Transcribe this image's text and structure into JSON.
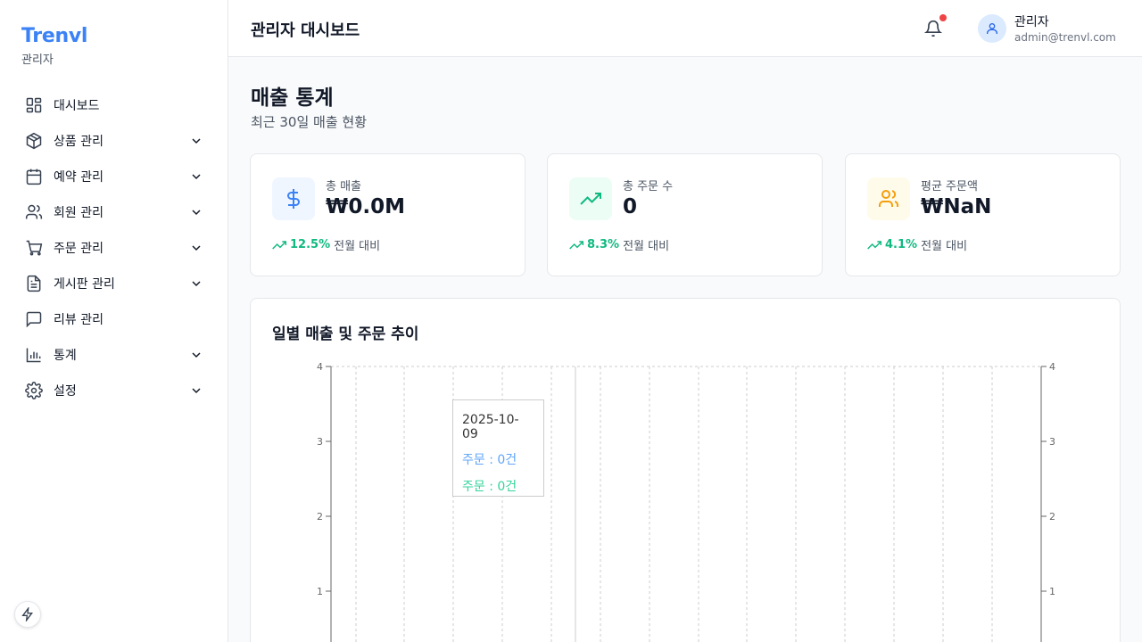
{
  "brand": {
    "name": "Trenvl",
    "subtitle": "관리자"
  },
  "nav": [
    {
      "label": "대시보드",
      "icon": "dashboard-icon",
      "has_submenu": false
    },
    {
      "label": "상품 관리",
      "icon": "package-icon",
      "has_submenu": true
    },
    {
      "label": "예약 관리",
      "icon": "calendar-icon",
      "has_submenu": true
    },
    {
      "label": "회원 관리",
      "icon": "users-icon",
      "has_submenu": true
    },
    {
      "label": "주문 관리",
      "icon": "cart-icon",
      "has_submenu": true
    },
    {
      "label": "게시판 관리",
      "icon": "document-icon",
      "has_submenu": true
    },
    {
      "label": "리뷰 관리",
      "icon": "message-icon",
      "has_submenu": false
    },
    {
      "label": "통계",
      "icon": "bar-chart-icon",
      "has_submenu": true
    },
    {
      "label": "설정",
      "icon": "gear-icon",
      "has_submenu": true
    }
  ],
  "header": {
    "title": "관리자 대시보드",
    "user_name": "관리자",
    "user_email": "admin@trenvl.com",
    "has_notification": true
  },
  "page": {
    "title": "매출 통계",
    "subtitle": "최근 30일 매출 현황"
  },
  "stats": [
    {
      "label": "총 매출",
      "value": "₩0.0M",
      "change": "12.5%",
      "compare": "전월 대비",
      "icon": "dollar-icon",
      "color": "#3b82f6",
      "bg": "#eff6ff"
    },
    {
      "label": "총 주문 수",
      "value": "0",
      "change": "8.3%",
      "compare": "전월 대비",
      "icon": "trending-up-icon",
      "color": "#10b981",
      "bg": "#ecfdf5"
    },
    {
      "label": "평균 주문액",
      "value": "₩NaN",
      "change": "4.1%",
      "compare": "전월 대비",
      "icon": "users-icon",
      "color": "#f59e0b",
      "bg": "#fffbeb"
    }
  ],
  "chart": {
    "title": "일별 매출 및 주문 추이",
    "tooltip": {
      "date": "2025-10-09",
      "line1": "주문 : 0건",
      "line2": "주문 : 0건",
      "line1_color": "#60a5fa",
      "line2_color": "#34d399"
    }
  },
  "chart_data": {
    "type": "line",
    "title": "일별 매출 및 주문 추이",
    "y_left_ticks": [
      "1",
      "2",
      "3",
      "4"
    ],
    "y_right_ticks": [
      "1",
      "2",
      "3",
      "4"
    ],
    "ylim": [
      0,
      4
    ],
    "series": [
      {
        "name": "주문",
        "values": [],
        "color": "#60a5fa"
      },
      {
        "name": "주문",
        "values": [],
        "color": "#34d399"
      }
    ],
    "grid": true
  }
}
